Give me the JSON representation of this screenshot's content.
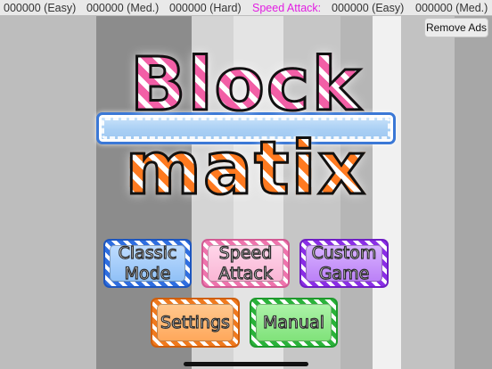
{
  "topbar": {
    "easy_1": "000000 (Easy)",
    "med_1": "000000 (Med.)",
    "hard_1": "000000 (Hard)",
    "speed_attack_label": "Speed Attack:",
    "easy_2": "000000 (Easy)",
    "med_2": "000000 (Med.)"
  },
  "remove_ads": "Remove Ads",
  "title": {
    "line1": "Block",
    "line2": "matix"
  },
  "menu": {
    "classic": "Classic\nMode",
    "speed": "Speed\nAttack",
    "custom": "Custom\nGame",
    "settings": "Settings",
    "manual": "Manual"
  },
  "colors": {
    "speed_attack": "#e21ee2",
    "classic": "#2f6ee0",
    "speed": "#ee74ad",
    "custom": "#8b2ee6",
    "settings": "#f07a1e",
    "manual": "#2ab33a"
  }
}
